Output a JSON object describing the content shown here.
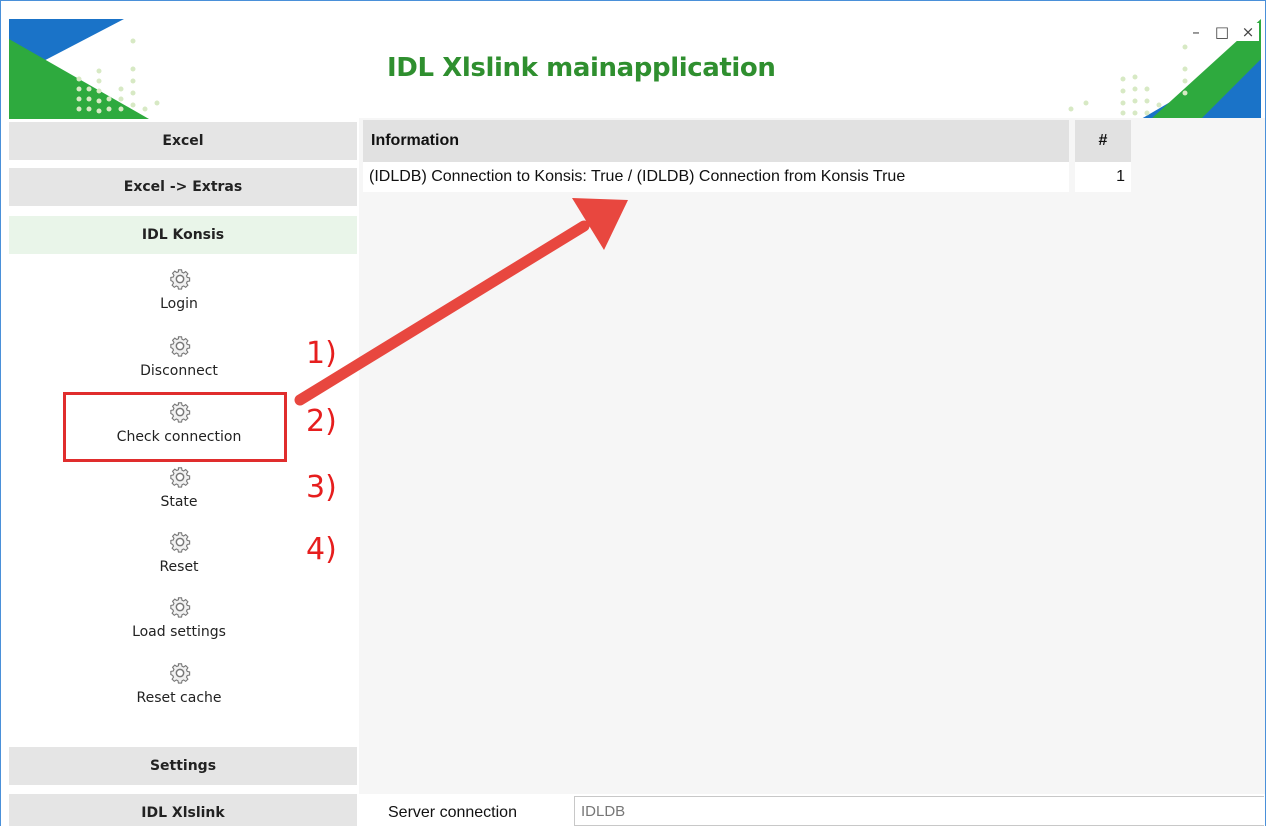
{
  "app": {
    "title": "IDL Xlslink mainapplication",
    "window_controls": [
      "–",
      "□",
      "×"
    ]
  },
  "sidebar": {
    "sections": {
      "excel": "Excel",
      "extras": "Excel -> Extras",
      "konsis": "IDL Konsis",
      "settings": "Settings",
      "xlslink": "IDL Xlslink"
    },
    "tools": [
      {
        "label": "Login",
        "icon": "gear-icon"
      },
      {
        "label": "Disconnect",
        "icon": "gear-icon"
      },
      {
        "label": "Check connection",
        "icon": "gear-icon"
      },
      {
        "label": "State",
        "icon": "gear-icon"
      },
      {
        "label": "Reset",
        "icon": "gear-icon"
      },
      {
        "label": "Load settings",
        "icon": "gear-icon"
      },
      {
        "label": "Reset cache",
        "icon": "gear-icon"
      }
    ]
  },
  "annotations": {
    "steps": [
      "1)",
      "2)",
      "3)",
      "4)"
    ],
    "color": "#e61e1e",
    "arrow_color": "#e8473f"
  },
  "table": {
    "columns": [
      "Information",
      "#"
    ],
    "rows": [
      {
        "information": "(IDLDB) Connection to Konsis: True / (IDLDB) Connection from Konsis True",
        "count": "1"
      }
    ]
  },
  "status": {
    "label": "Server connection",
    "value": "IDLDB"
  },
  "colors": {
    "title_green": "#2f8f2f",
    "logo_blue": "#1a73c8",
    "logo_green": "#2eaa3e"
  }
}
